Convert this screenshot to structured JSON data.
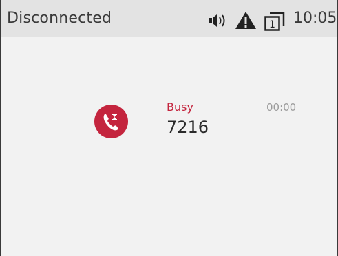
{
  "status_bar": {
    "title": "Disconnected",
    "time": "10:05",
    "icons": [
      "ringer-volume-icon",
      "warning-icon",
      "line-1-icon"
    ],
    "line_number": "1"
  },
  "call": {
    "status": "Busy",
    "number": "7216",
    "duration": "00:00",
    "icon": "phone-busy-icon",
    "accent_color": "#c4253e"
  }
}
